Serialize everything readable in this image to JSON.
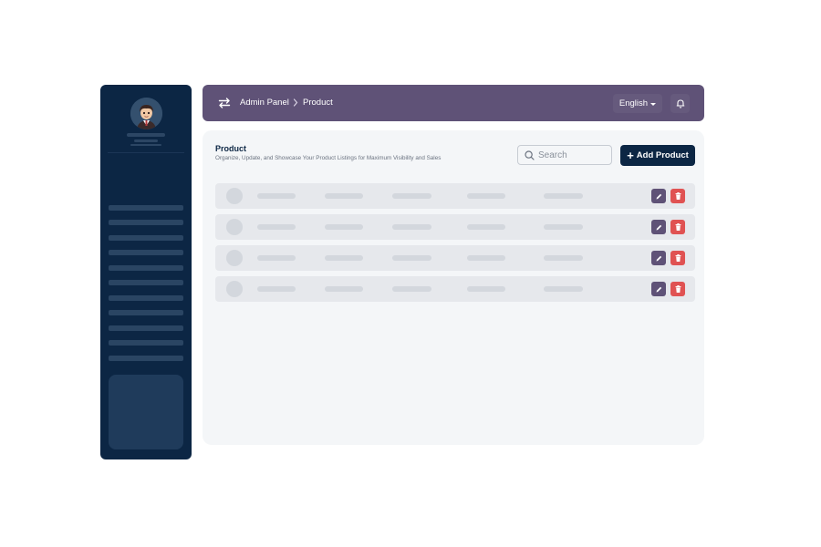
{
  "topbar": {
    "breadcrumb": [
      "Admin Panel",
      "Product"
    ],
    "language": "English"
  },
  "page": {
    "title": "Product",
    "subtitle": "Organize, Update, and Showcase Your Product Listings for Maximum Visibility and Sales"
  },
  "search": {
    "placeholder": "Search",
    "value": ""
  },
  "add_button": {
    "label": "Add Product"
  },
  "icons": {
    "swap": "swap-arrows-icon",
    "breadcrumb_separator": "chevron-right-icon",
    "language_caret": "caret-down-icon",
    "notifications": "bell-icon",
    "search": "search-icon",
    "add": "plus-icon",
    "edit": "pencil-icon",
    "delete": "trash-icon"
  },
  "colors": {
    "sidebar": "#0c2644",
    "topbar": "#5f5277",
    "primary_button": "#0c2644",
    "edit": "#5f5277",
    "delete": "#e05252"
  },
  "table": {
    "row_count": 4
  }
}
